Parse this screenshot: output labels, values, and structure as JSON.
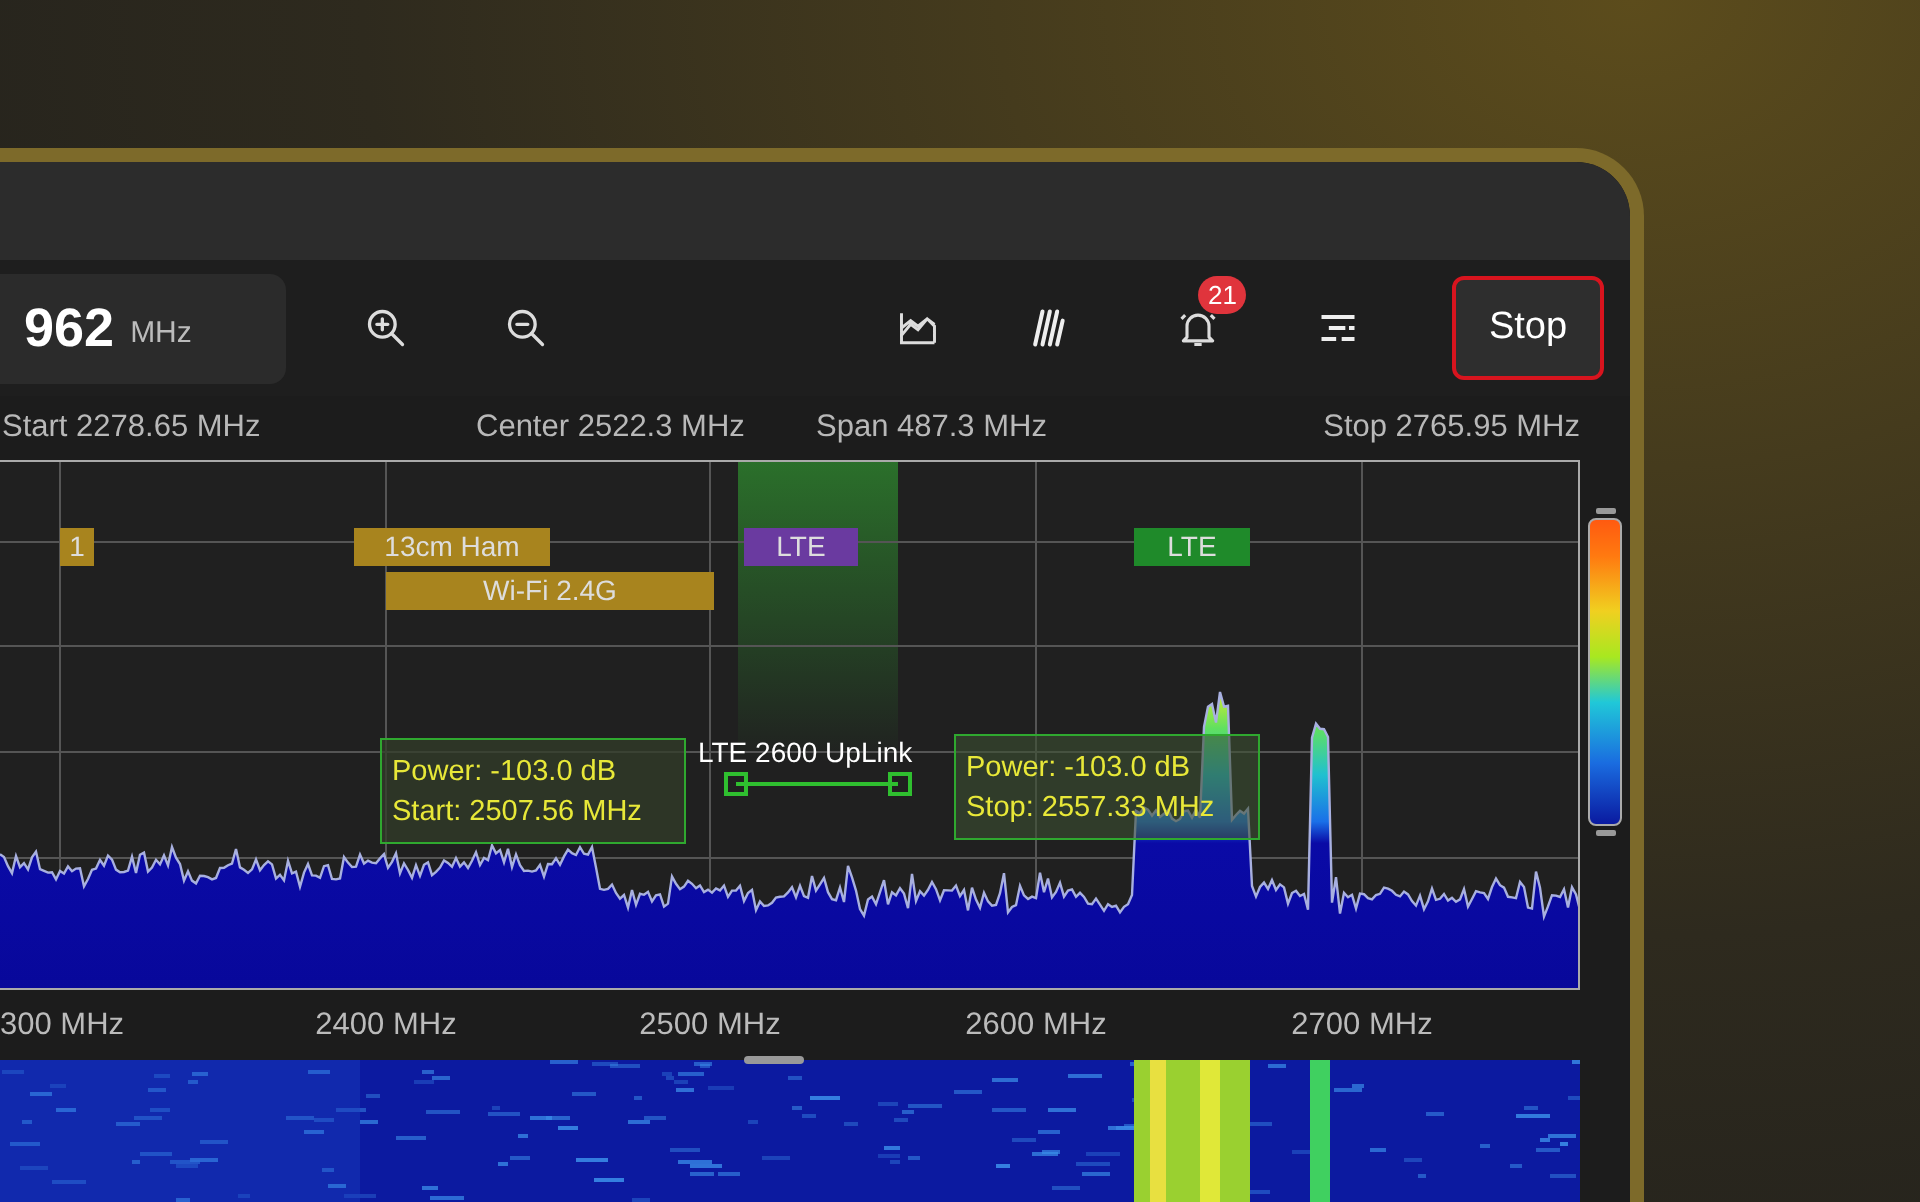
{
  "frequency": {
    "value": "962",
    "unit": "MHz"
  },
  "toolbar": {
    "notification_badge": "21",
    "stop_button": "Stop"
  },
  "info": {
    "start": "Start 2278.65 MHz",
    "center": "Center 2522.3 MHz",
    "span": "Span 487.3 MHz",
    "stop": "Stop 2765.95 MHz"
  },
  "bands": [
    {
      "label": "1",
      "color": "#a8841e"
    },
    {
      "label": "13cm Ham",
      "color": "#a8841e"
    },
    {
      "label": "Wi-Fi 2.4G",
      "color": "#a8841e"
    },
    {
      "label": "LTE",
      "color": "#6a3aa0"
    },
    {
      "label": "LTE",
      "color": "#1f8a2a"
    }
  ],
  "marker": {
    "label": "LTE 2600 UpLink",
    "start_readout": [
      "Power: -103.0 dB",
      "Start: 2507.56 MHz"
    ],
    "stop_readout": [
      "Power: -103.0 dB",
      "Stop: 2557.33 MHz"
    ]
  },
  "x_axis_labels": [
    "300 MHz",
    "2400 MHz",
    "2500 MHz",
    "2600 MHz",
    "2700 MHz"
  ]
}
